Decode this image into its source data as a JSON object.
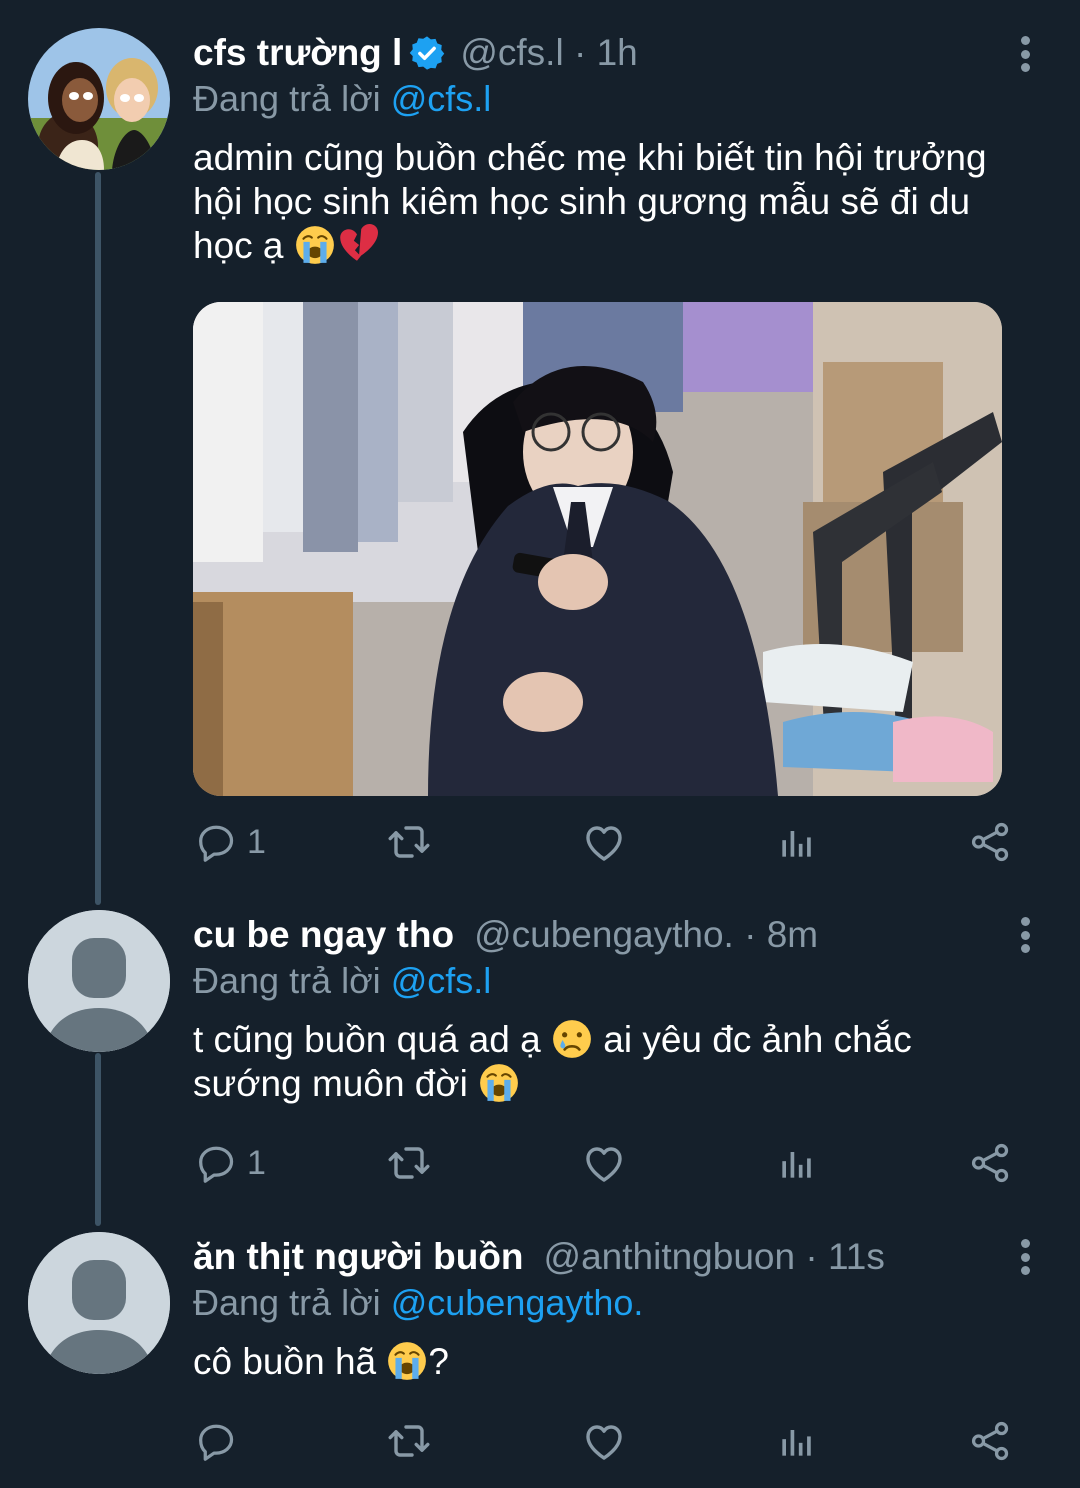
{
  "tweets": [
    {
      "name": "cfs trường l",
      "verified": true,
      "handle_time": "@cfs.l · 1h",
      "reply_prefix": "Đang trả lời",
      "reply_mention": "@cfs.l",
      "text_line1": "admin cũng buồn chếc mẹ khi biết tin hội trưởng",
      "text_line2": "hội học sinh kiêm học sinh gương mẫu sẽ đi du",
      "text_line3": "học ạ",
      "reply_count": "1",
      "avatar": "cartoon-dolls-avatar",
      "media": "photo-young-man-in-suit-looking-at-phone"
    },
    {
      "name": "cu be ngay tho",
      "verified": false,
      "handle_time": "@cubengaytho. · 8m",
      "reply_prefix": "Đang trả lời",
      "reply_mention": "@cfs.l",
      "text_line1": "t cũng buồn quá ad ạ",
      "text_line1b": "ai yêu đc ảnh chắc",
      "text_line2": "sướng muôn đời",
      "reply_count": "1",
      "avatar": "default-avatar"
    },
    {
      "name": "ăn thịt người buồn",
      "verified": false,
      "handle_time": "@anthitngbuon · 11s",
      "reply_prefix": "Đang trả lời",
      "reply_mention": "@cubengaytho.",
      "text_pre": "cô buồn hã",
      "text_post": "?",
      "reply_count": "",
      "avatar": "default-avatar"
    }
  ],
  "icons": [
    "reply-icon",
    "retweet-icon",
    "like-icon",
    "analytics-icon",
    "share-icon",
    "more-icon",
    "verified-icon",
    "loudly-crying-emoji",
    "broken-heart-emoji",
    "crying-emoji"
  ],
  "colors": {
    "background": "#15202b",
    "secondary_text": "#8899a6",
    "accent": "#1da1f2",
    "thread_line": "#3d5466"
  }
}
